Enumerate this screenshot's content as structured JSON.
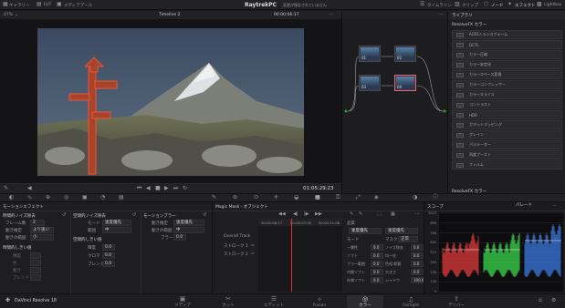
{
  "topbar": {
    "media_pool": "ギャラリー",
    "lut": "LUT",
    "media_card": "メディアプール",
    "project_title": "RaytrekPC",
    "edited": "変更が保存されていません",
    "timeline": "タイムライン",
    "clips": "クリップ",
    "nodes": "ノード",
    "effects": "エフェクト",
    "lightbox": "Lightbox"
  },
  "viewer": {
    "zoom": "47%",
    "timeline_name": "Timeline 2",
    "timecode_top": "00:00:06:17",
    "clip_label": "クリップ",
    "timecode": "01:05:29:23"
  },
  "library": {
    "tab_library": "ライブラリ",
    "header": "ResolveFX カラー",
    "items": [
      "ACESトランスフォーム",
      "DCTL",
      "カラー圧縮",
      "カラー安定化",
      "カラースペース変換",
      "カラーコンプレッサー",
      "カラースライス",
      "コントラスト",
      "HDR",
      "ガマットマッピング",
      "グレイン",
      "パラメーター",
      "再度ブースト",
      "フィルム"
    ],
    "footer_header": "ResolveFX カラー"
  },
  "nodes": [
    {
      "label": "01"
    },
    {
      "label": "02"
    },
    {
      "label": "03"
    },
    {
      "label": "04"
    }
  ],
  "motion_effects": {
    "title": "モーションエフェクト",
    "temporal_nr": "時間的ノイズ除去",
    "frames_label": "フレーム数",
    "frames_value": "2",
    "mo_est_label": "動き推定",
    "mo_est_value": "より速い",
    "mo_range_label": "動きの範囲",
    "mo_range_value": "小",
    "temporal_thresh": "時間的しきい値",
    "luma": "輝度",
    "chroma": "色",
    "motion": "動き",
    "blend": "ブレンド",
    "spatial_nr": "空間的ノイズ除去",
    "mode_label": "モード",
    "mode_value": "速度優先",
    "radius_label": "範囲",
    "radius_value": "中",
    "spatial_thresh": "空間的しきい値",
    "sp_luma": "輝度",
    "sp_luma_value": "0.0",
    "sp_chroma": "クロマ",
    "sp_chroma_value": "0.0",
    "sp_blend": "ブレンド",
    "sp_blend_value": "0.0",
    "motion_blur": "モーションブラー",
    "mb_est_label": "動き推定",
    "mb_est_value": "速度優先",
    "mb_range_label": "動きの範囲",
    "mb_range_value": "中",
    "mb_blur_label": "ブラー",
    "mb_blur_value": "0.0"
  },
  "magic_mask": {
    "title": "Magic Mask - オブジェクト",
    "timecode_a": "00:00:06:17",
    "timecode_b": "00:00:07:05",
    "timecode_c": "00:00:11:08",
    "overall_track": "Overall Track",
    "stroke1": "ストローク 1",
    "stroke2": "ストローク 2",
    "quality": "品質",
    "mode_label": "モード",
    "mode_value": "速度優先",
    "mode_value2": "速度優先",
    "mask_label": "マスク",
    "props": [
      {
        "label": "一貫性",
        "value": "0.0"
      },
      {
        "label": "ソフト",
        "value": "0.0"
      },
      {
        "label": "ブラー範囲",
        "value": "0.0"
      },
      {
        "label": "内側ソフト",
        "value": "0.0"
      },
      {
        "label": "外側ソフト",
        "value": "0.0"
      }
    ],
    "props2": [
      {
        "label": "ノイズ除去",
        "value": "0.0"
      },
      {
        "label": "均一化",
        "value": "0.0"
      },
      {
        "label": "色相 影響",
        "value": "0.0"
      },
      {
        "label": "大きさ",
        "value": "0.0"
      },
      {
        "label": "シャドウ",
        "value": "100.0"
      }
    ],
    "preset_value": "正常"
  },
  "scope": {
    "title": "スコープ",
    "mode": "パレード",
    "ticks": [
      "1023",
      "896",
      "768",
      "640",
      "512",
      "384",
      "256",
      "128",
      "0"
    ],
    "colors": {
      "red": "#e03a3a",
      "green": "#3ad84a",
      "blue": "#3a7ae0"
    }
  },
  "bottom": {
    "app_name": "DaVinci Resolve 18",
    "tabs": [
      {
        "label": "メディア",
        "icon": "media-icon"
      },
      {
        "label": "カット",
        "icon": "cut-icon"
      },
      {
        "label": "エディット",
        "icon": "edit-icon"
      },
      {
        "label": "Fusion",
        "icon": "fusion-icon"
      },
      {
        "label": "カラー",
        "icon": "color-icon"
      },
      {
        "label": "Fairlight",
        "icon": "fairlight-icon"
      },
      {
        "label": "デリバー",
        "icon": "deliver-icon"
      }
    ]
  }
}
